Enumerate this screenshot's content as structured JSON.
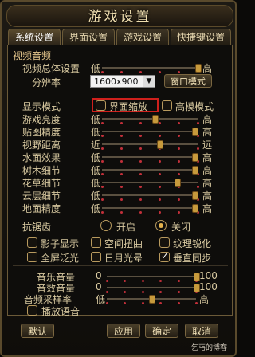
{
  "window": {
    "title": "游戏设置"
  },
  "tabs": [
    {
      "label": "系统设置",
      "active": true
    },
    {
      "label": "界面设置",
      "active": false
    },
    {
      "label": "游戏设置",
      "active": false
    },
    {
      "label": "快捷键设置",
      "active": false
    }
  ],
  "video_section": {
    "label": "视频音频"
  },
  "overall": {
    "label": "视频总体设置",
    "low": "低",
    "high": "高",
    "level": 1.0
  },
  "resolution": {
    "label": "分辨率",
    "value": "1600x900",
    "window_mode_button": "窗口模式"
  },
  "display_mode": {
    "label": "显示模式",
    "option1": "界面缩放",
    "option1_checked": false,
    "option2": "高模模式",
    "option2_checked": false
  },
  "quality_sliders": [
    {
      "label": "游戏亮度",
      "low": "低",
      "high": "高",
      "level": 0.55
    },
    {
      "label": "贴图精度",
      "low": "低",
      "high": "高",
      "level": 0.97
    },
    {
      "label": "视野距离",
      "low": "近",
      "high": "远",
      "level": 0.6
    },
    {
      "label": "水面效果",
      "low": "低",
      "high": "高",
      "level": 0.97
    },
    {
      "label": "树木细节",
      "low": "低",
      "high": "高",
      "level": 0.97
    },
    {
      "label": "花草细节",
      "low": "低",
      "high": "高",
      "level": 0.78
    },
    {
      "label": "云层细节",
      "low": "低",
      "high": "高",
      "level": 0.97
    },
    {
      "label": "地面精度",
      "low": "低",
      "high": "高",
      "level": 0.97
    }
  ],
  "antialias": {
    "label": "抗锯齿",
    "on": "开启",
    "off": "关闭",
    "selected": "关闭"
  },
  "effects": [
    {
      "label": "影子显示",
      "checked": false
    },
    {
      "label": "空间扭曲",
      "checked": false
    },
    {
      "label": "纹理锐化",
      "checked": false
    },
    {
      "label": "全屏泛光",
      "checked": false
    },
    {
      "label": "日月光晕",
      "checked": false
    },
    {
      "label": "垂直同步",
      "checked": true
    }
  ],
  "audio": [
    {
      "label": "音乐音量",
      "low": "0",
      "high": "100",
      "level": 1.0
    },
    {
      "label": "音效音量",
      "low": "0",
      "high": "100",
      "level": 1.0
    },
    {
      "label": "音频采样率",
      "low": "低",
      "high": "高",
      "level": 0.5
    }
  ],
  "play_voice": {
    "label": "播放语音",
    "checked": false
  },
  "buttons": {
    "default": "默认",
    "apply": "应用",
    "ok": "确定",
    "cancel": "取消"
  },
  "watermark": "乞丐的博客"
}
